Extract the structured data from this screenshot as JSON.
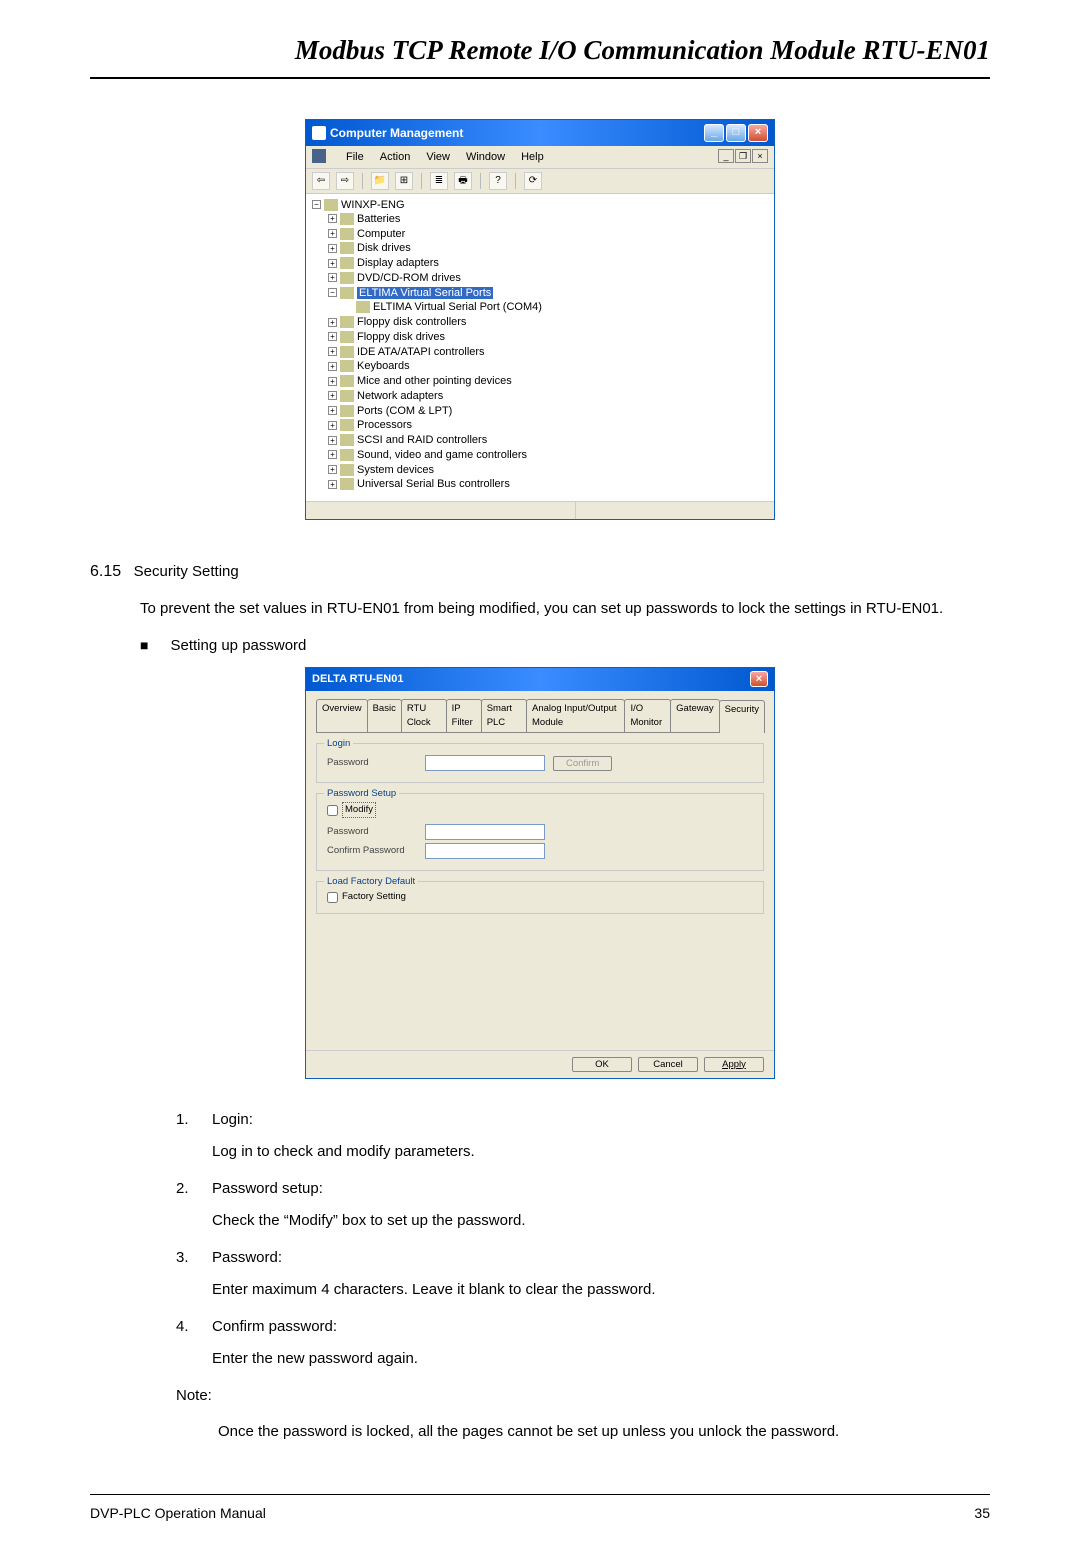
{
  "header_title": "Modbus TCP Remote I/O Communication Module RTU-EN01",
  "dm": {
    "title": "Computer Management",
    "menus": [
      "File",
      "Action",
      "View",
      "Window",
      "Help"
    ],
    "root": "WINXP-ENG",
    "items": [
      "Batteries",
      "Computer",
      "Disk drives",
      "Display adapters",
      "DVD/CD-ROM drives"
    ],
    "eltima_parent": "ELTIMA Virtual Serial Ports",
    "eltima_child": "ELTIMA Virtual Serial Port (COM4)",
    "items2": [
      "Floppy disk controllers",
      "Floppy disk drives",
      "IDE ATA/ATAPI controllers",
      "Keyboards",
      "Mice and other pointing devices",
      "Network adapters",
      "Ports (COM & LPT)",
      "Processors",
      "SCSI and RAID controllers",
      "Sound, video and game controllers",
      "System devices",
      "Universal Serial Bus controllers"
    ]
  },
  "section": {
    "num": "6.15",
    "title": "Security Setting",
    "intro": "To prevent the set values in RTU-EN01 from being modified, you can set up passwords to lock the settings in RTU-EN01.",
    "bullet": "Setting up password"
  },
  "sec_dialog": {
    "title": "DELTA RTU-EN01",
    "tabs": [
      "Overview",
      "Basic",
      "RTU Clock",
      "IP Filter",
      "Smart PLC",
      "Analog Input/Output Module",
      "I/O Monitor",
      "Gateway",
      "Security"
    ],
    "active_tab": "Security",
    "group_login": "Login",
    "login_password": "Password",
    "login_confirm": "Confirm",
    "group_setup": "Password Setup",
    "modify": "Modify",
    "setup_password": "Password",
    "setup_confirm": "Confirm Password",
    "group_factory": "Load Factory Default",
    "factory_check": "Factory Setting",
    "ok": "OK",
    "cancel": "Cancel",
    "apply": "Apply"
  },
  "list": {
    "n1": "1.",
    "t1": "Login:",
    "d1": "Log in to check and modify parameters.",
    "n2": "2.",
    "t2": "Password setup:",
    "d2": "Check the “Modify” box to set up the password.",
    "n3": "3.",
    "t3": "Password:",
    "d3": "Enter maximum 4 characters. Leave it blank to clear the password.",
    "n4": "4.",
    "t4": "Confirm password:",
    "d4": "Enter the new password again.",
    "note_label": "Note:",
    "note_text": "Once the password is locked, all the pages cannot be set up unless you unlock the password."
  },
  "footer": {
    "left": "DVP-PLC Operation Manual",
    "right": "35"
  }
}
